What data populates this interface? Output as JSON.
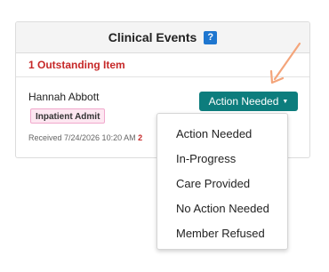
{
  "panel": {
    "title": "Clinical Events",
    "help_badge": "?",
    "outstanding": "1 Outstanding Item"
  },
  "event": {
    "patient_name": "Hannah Abbott",
    "tag": "Inpatient Admit",
    "received": "Received 7/24/2026 10:20 AM",
    "received_trailing": "2"
  },
  "action_button": {
    "label": "Action Needed",
    "caret_icon": "caret-down-icon"
  },
  "dropdown": {
    "items": [
      {
        "label": "Action Needed"
      },
      {
        "label": "In-Progress"
      },
      {
        "label": "Care Provided"
      },
      {
        "label": "No Action Needed"
      },
      {
        "label": "Member Refused"
      }
    ]
  },
  "colors": {
    "accent_teal": "#0d7d7d",
    "help_blue": "#1e76cf",
    "alert_red": "#c62828",
    "tag_pink": "#fde7f1",
    "annotation_arrow": "#f4a57b"
  },
  "annotation": {
    "icon": "pointer-arrow-icon"
  }
}
